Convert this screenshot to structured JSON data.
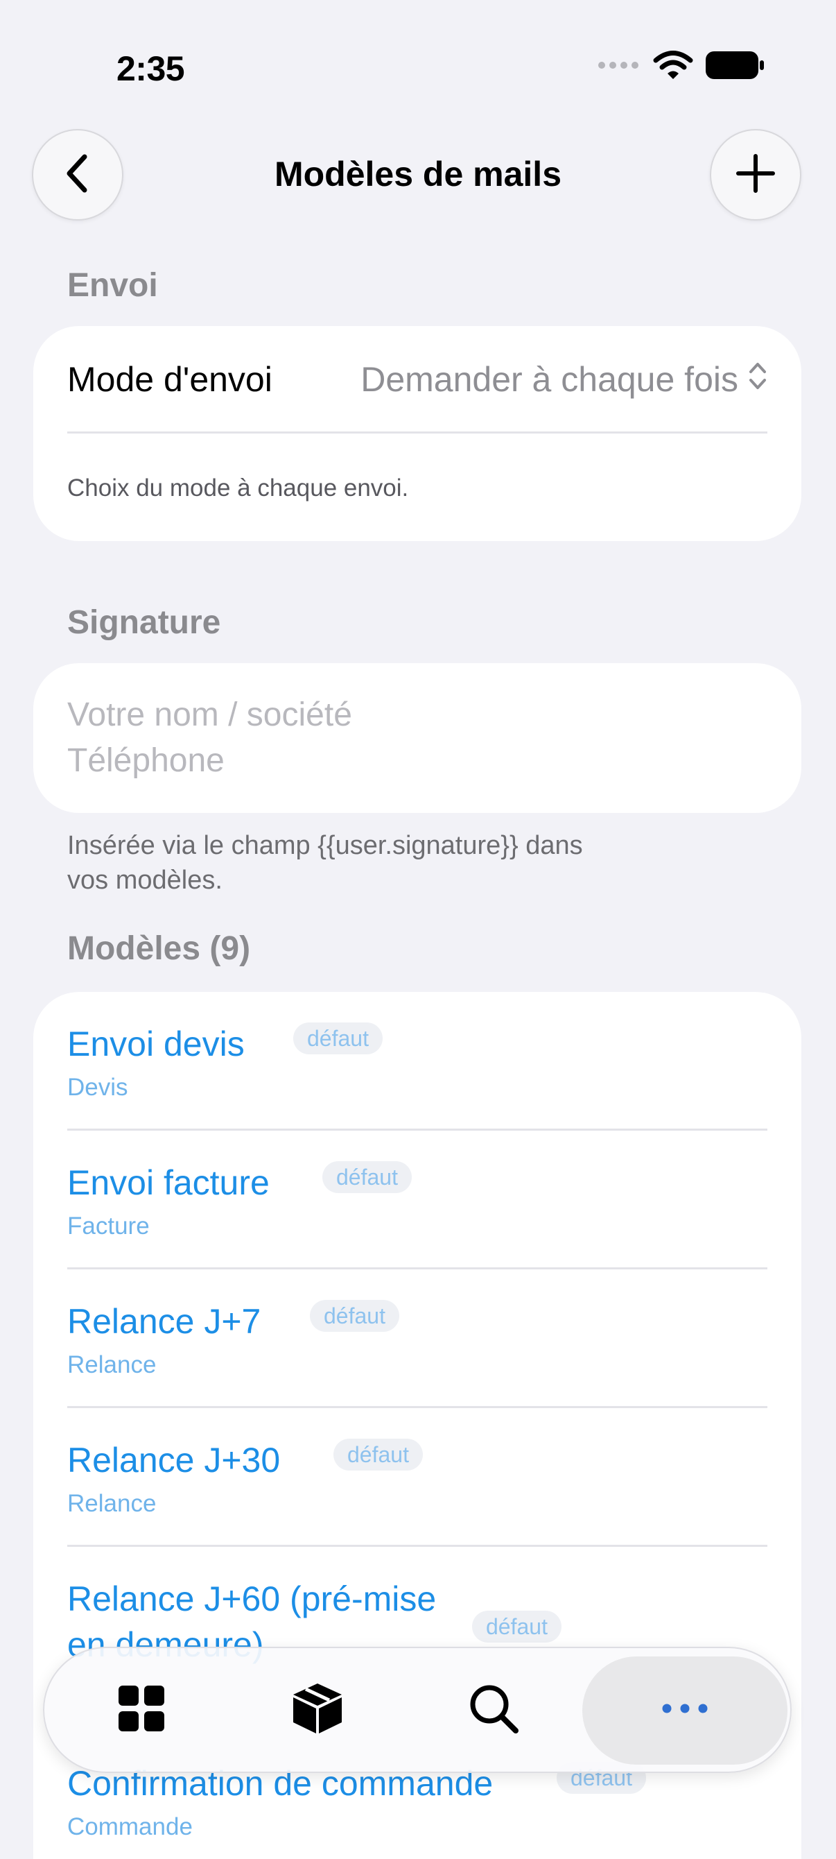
{
  "status_bar": {
    "time": "2:35",
    "wifi_icon": "wifi-icon",
    "battery_icon": "battery-icon",
    "signal_icon": "cellular-dots-icon"
  },
  "nav": {
    "title": "Modèles de mails",
    "back_icon": "chevron-left-icon",
    "add_icon": "plus-icon"
  },
  "envoi": {
    "header": "Envoi",
    "mode_label": "Mode d'envoi",
    "mode_value": "Demander à chaque fois",
    "mode_icon": "chevron-up-down-icon",
    "caption": "Choix du mode à chaque envoi."
  },
  "signature": {
    "header": "Signature",
    "placeholder_line1": "Votre nom / société",
    "placeholder_line2": "Téléphone",
    "footer_line1": "Insérée via le champ {{user.signature}} dans",
    "footer_line2": "vos modèles."
  },
  "templates": {
    "header": "Modèles (9)",
    "items": [
      {
        "title": "Envoi devis",
        "badge": "défaut",
        "category": "Devis"
      },
      {
        "title": "Envoi facture",
        "badge": "défaut",
        "category": "Facture"
      },
      {
        "title": "Relance J+7",
        "badge": "défaut",
        "category": "Relance"
      },
      {
        "title": "Relance J+30",
        "badge": "défaut",
        "category": "Relance"
      },
      {
        "title": "Relance J+60 (pré-mise",
        "title_line2": "en demeure)",
        "badge": "défaut",
        "category": ""
      },
      {
        "title": "Confirmation de commande",
        "badge": "défaut",
        "category": "Commande"
      }
    ]
  },
  "tabbar": {
    "tabs": [
      {
        "icon": "grid-icon"
      },
      {
        "icon": "package-icon"
      },
      {
        "icon": "search-icon"
      },
      {
        "icon": "more-icon",
        "active": true
      }
    ]
  },
  "colors": {
    "accent": "#1c8ee6",
    "background": "#f2f2f7",
    "card": "#ffffff",
    "secondary_text": "#8e8e93"
  }
}
